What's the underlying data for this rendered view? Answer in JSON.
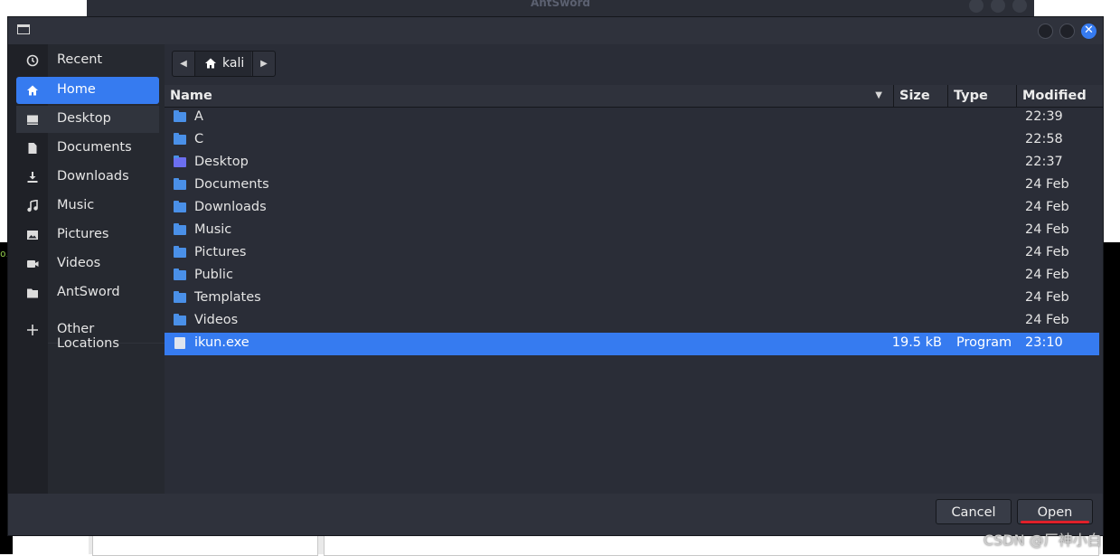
{
  "background": {
    "window_title": "AntSword"
  },
  "dialog": {
    "sidebar": [
      {
        "label": "Recent",
        "icon": "clock-icon"
      },
      {
        "label": "Home",
        "icon": "home-icon",
        "active": true
      },
      {
        "label": "Desktop",
        "icon": "desktop-icon"
      },
      {
        "label": "Documents",
        "icon": "document-icon"
      },
      {
        "label": "Downloads",
        "icon": "download-icon"
      },
      {
        "label": "Music",
        "icon": "music-icon"
      },
      {
        "label": "Pictures",
        "icon": "picture-icon"
      },
      {
        "label": "Videos",
        "icon": "video-icon"
      },
      {
        "label": "AntSword",
        "icon": "folder-icon"
      },
      {
        "label": "Other Locations",
        "icon": "plus-icon"
      }
    ],
    "path": {
      "current": "kali"
    },
    "columns": {
      "name": "Name",
      "size": "Size",
      "type": "Type",
      "modified": "Modified"
    },
    "files": [
      {
        "name": "A",
        "size": "",
        "type": "",
        "modified": "22:39"
      },
      {
        "name": "C",
        "size": "",
        "type": "",
        "modified": "22:58"
      },
      {
        "name": "Desktop",
        "size": "",
        "type": "",
        "modified": "22:37"
      },
      {
        "name": "Documents",
        "size": "",
        "type": "",
        "modified": "24 Feb"
      },
      {
        "name": "Downloads",
        "size": "",
        "type": "",
        "modified": "24 Feb"
      },
      {
        "name": "Music",
        "size": "",
        "type": "",
        "modified": "24 Feb"
      },
      {
        "name": "Pictures",
        "size": "",
        "type": "",
        "modified": "24 Feb"
      },
      {
        "name": "Public",
        "size": "",
        "type": "",
        "modified": "24 Feb"
      },
      {
        "name": "Templates",
        "size": "",
        "type": "",
        "modified": "24 Feb"
      },
      {
        "name": "Videos",
        "size": "",
        "type": "",
        "modified": "24 Feb"
      },
      {
        "name": "ikun.exe",
        "size": "19.5 kB",
        "type": "Program",
        "modified": "23:10",
        "selected": true
      }
    ],
    "buttons": {
      "cancel": "Cancel",
      "open": "Open"
    }
  },
  "watermark": "CSDN @厂神小白",
  "colors": {
    "accent": "#367bf0",
    "folder": "#4a90e8",
    "dialog_bg": "#2a2d37",
    "annotation_red": "#e0202a"
  }
}
